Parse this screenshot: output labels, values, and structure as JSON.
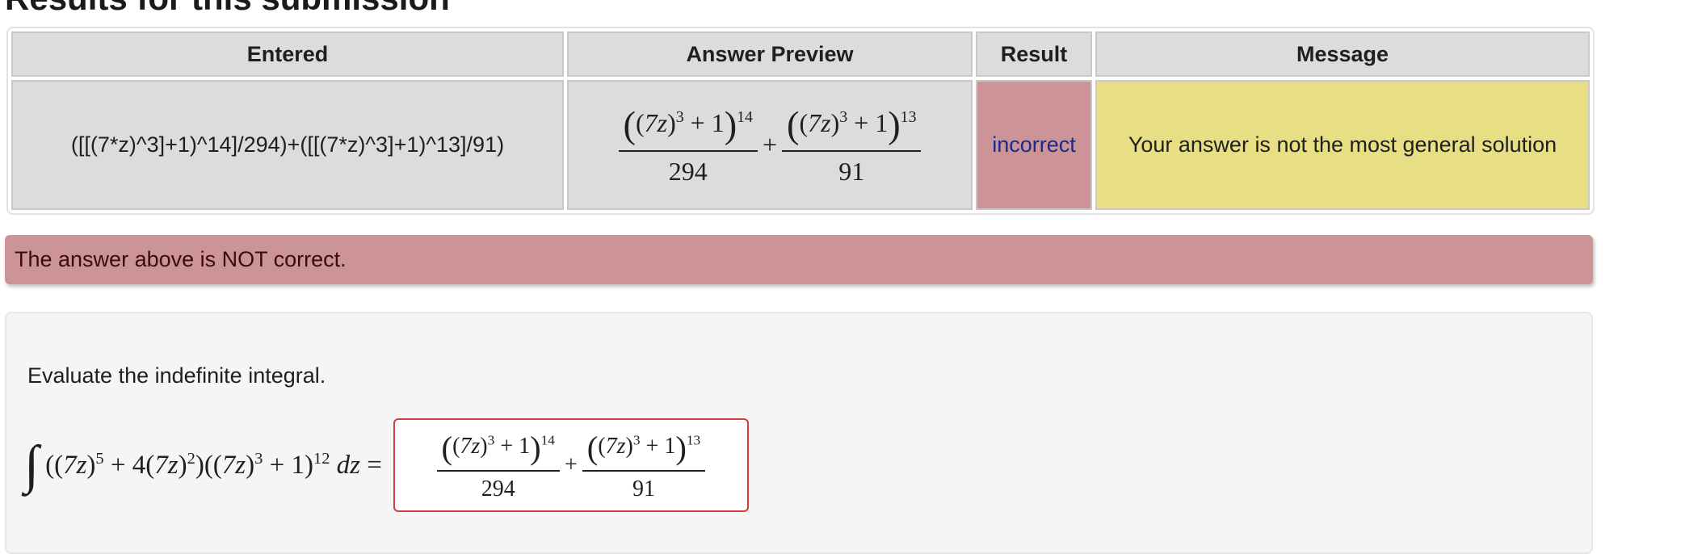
{
  "page": {
    "title": "Results for this submission"
  },
  "results_table": {
    "headers": {
      "entered": "Entered",
      "preview": "Answer Preview",
      "result": "Result",
      "message": "Message"
    },
    "row": {
      "entered": "([[(7*z)^3]+1)^14]/294)+([[(7*z)^3]+1)^13]/91)",
      "preview": {
        "term1_base": "7z",
        "term1_inner_exp": "3",
        "term1_plus": "+ 1",
        "term1_exp": "14",
        "term1_den": "294",
        "plus": "+",
        "term2_base": "7z",
        "term2_inner_exp": "3",
        "term2_plus": "+ 1",
        "term2_exp": "13",
        "term2_den": "91"
      },
      "result": "incorrect",
      "message": "Your answer is not the most general solution"
    },
    "colors": {
      "header_bg": "#dcdcdc",
      "incorrect_bg": "#cc9496",
      "incorrect_text": "#1c2a8a",
      "message_bg": "#e8df84"
    }
  },
  "alert": {
    "text": "The answer above is NOT correct.",
    "color": "#cc9496"
  },
  "problem": {
    "prompt": "Evaluate the indefinite integral.",
    "integrand": {
      "integral_sign": "∫",
      "a_base": "7z",
      "a_exp": "5",
      "b_coef": "+ 4",
      "b_base": "7z",
      "b_exp": "2",
      "c_base": "7z",
      "c_inner_exp": "3",
      "c_plus": "+ 1",
      "c_exp": "12",
      "differential": "dz",
      "equals": "="
    },
    "answer_input": {
      "term1_base": "7z",
      "term1_inner_exp": "3",
      "term1_plus": "+ 1",
      "term1_exp": "14",
      "term1_den": "294",
      "plus": "+",
      "term2_base": "7z",
      "term2_inner_exp": "3",
      "term2_plus": "+ 1",
      "term2_exp": "13",
      "term2_den": "91",
      "border_color": "#d23c3c"
    }
  }
}
